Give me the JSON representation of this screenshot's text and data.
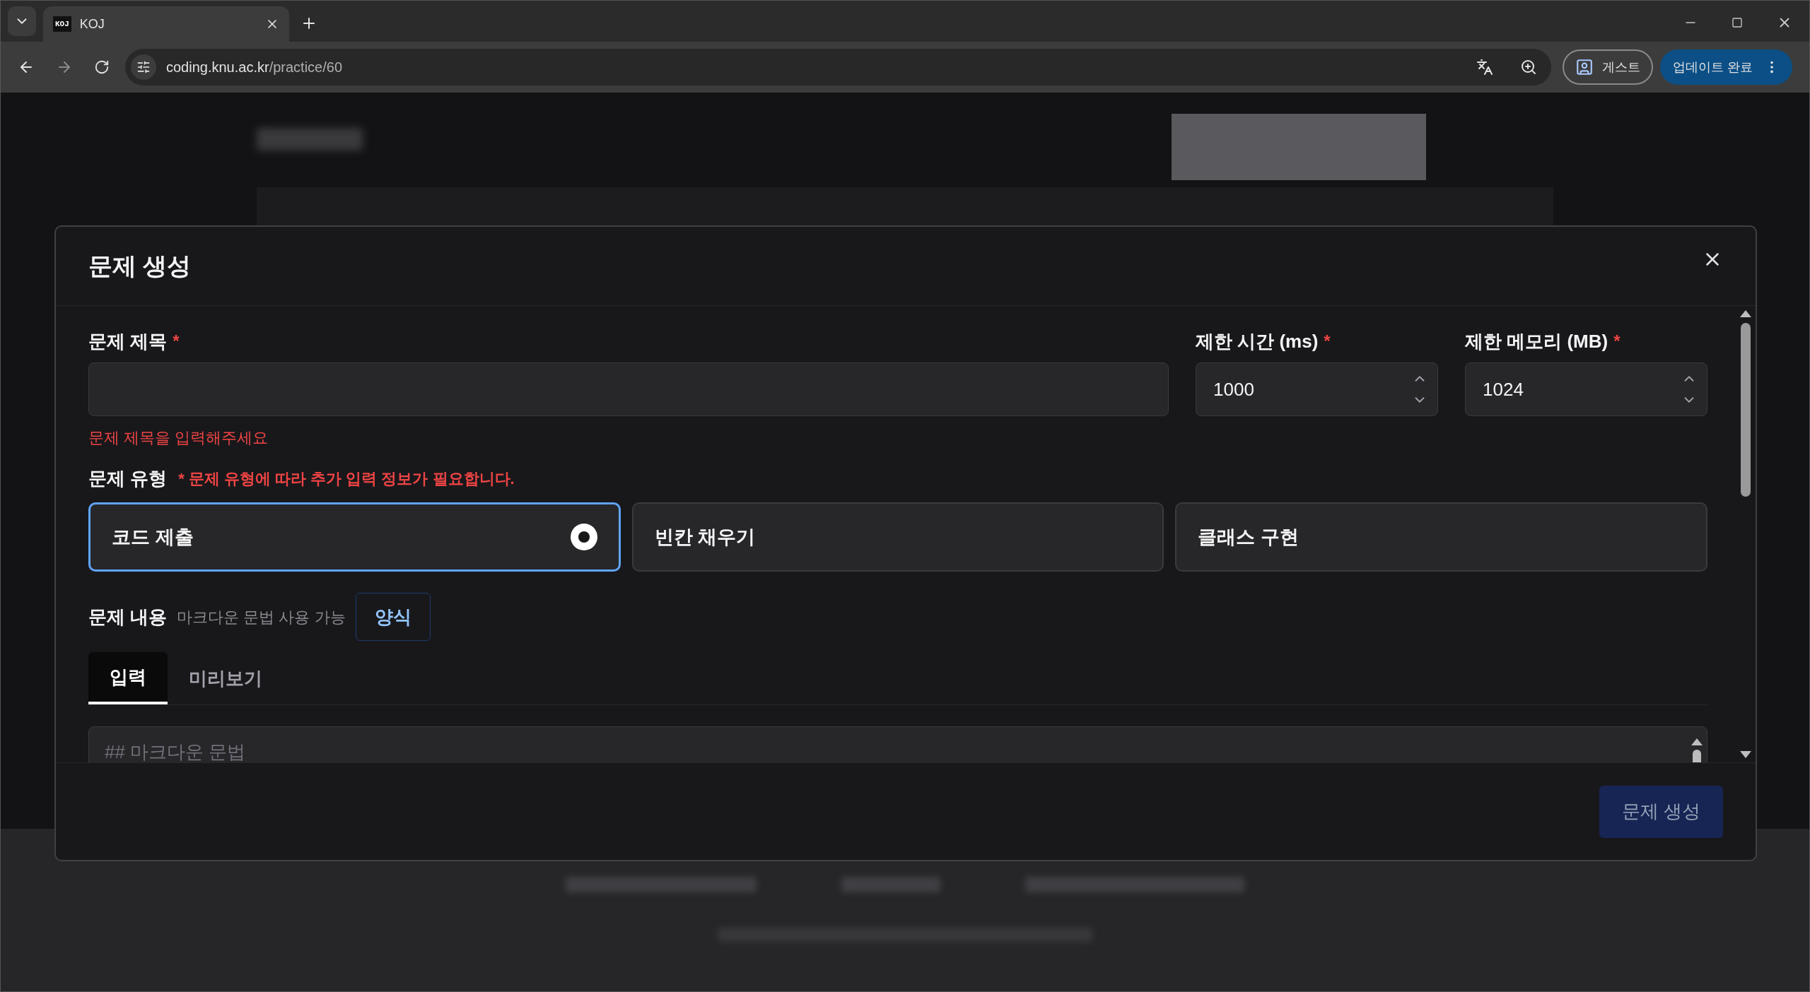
{
  "browser": {
    "tab": {
      "favicon": "KOJ",
      "title": "KOJ"
    },
    "url": {
      "host": "coding.knu.ac.kr",
      "path": "/practice/60"
    },
    "profile": "게스트",
    "update": "업데이트 완료"
  },
  "modal": {
    "title": "문제 생성",
    "fields": [
      {
        "label": "문제 제목",
        "required_mark": "*",
        "kind": "text",
        "error": "문제 제목을 입력해주세요"
      },
      {
        "label": "제한 시간 (ms)",
        "required_mark": "*",
        "value": "1000",
        "kind": "number"
      },
      {
        "label": "제한 메모리 (MB)",
        "required_mark": "*",
        "value": "1024",
        "kind": "number"
      }
    ],
    "type_label": "문제 유형",
    "type_note": "* 문제 유형에 따라 추가 입력 정보가 필요합니다.",
    "types": [
      {
        "label": "코드 제출",
        "selected": true
      },
      {
        "label": "빈칸 채우기",
        "selected": false
      },
      {
        "label": "클래스 구현",
        "selected": false
      }
    ],
    "content_label": "문제 내용",
    "content_hint": "마크다운 문법 사용 가능",
    "template_button": "양식",
    "tabs": [
      {
        "label": "입력",
        "selected": true
      },
      {
        "label": "미리보기",
        "selected": false
      }
    ],
    "editor": {
      "placeholder": "## 마크다운 문법"
    },
    "submit": {
      "label": "문제 생성",
      "disabled": true
    }
  }
}
